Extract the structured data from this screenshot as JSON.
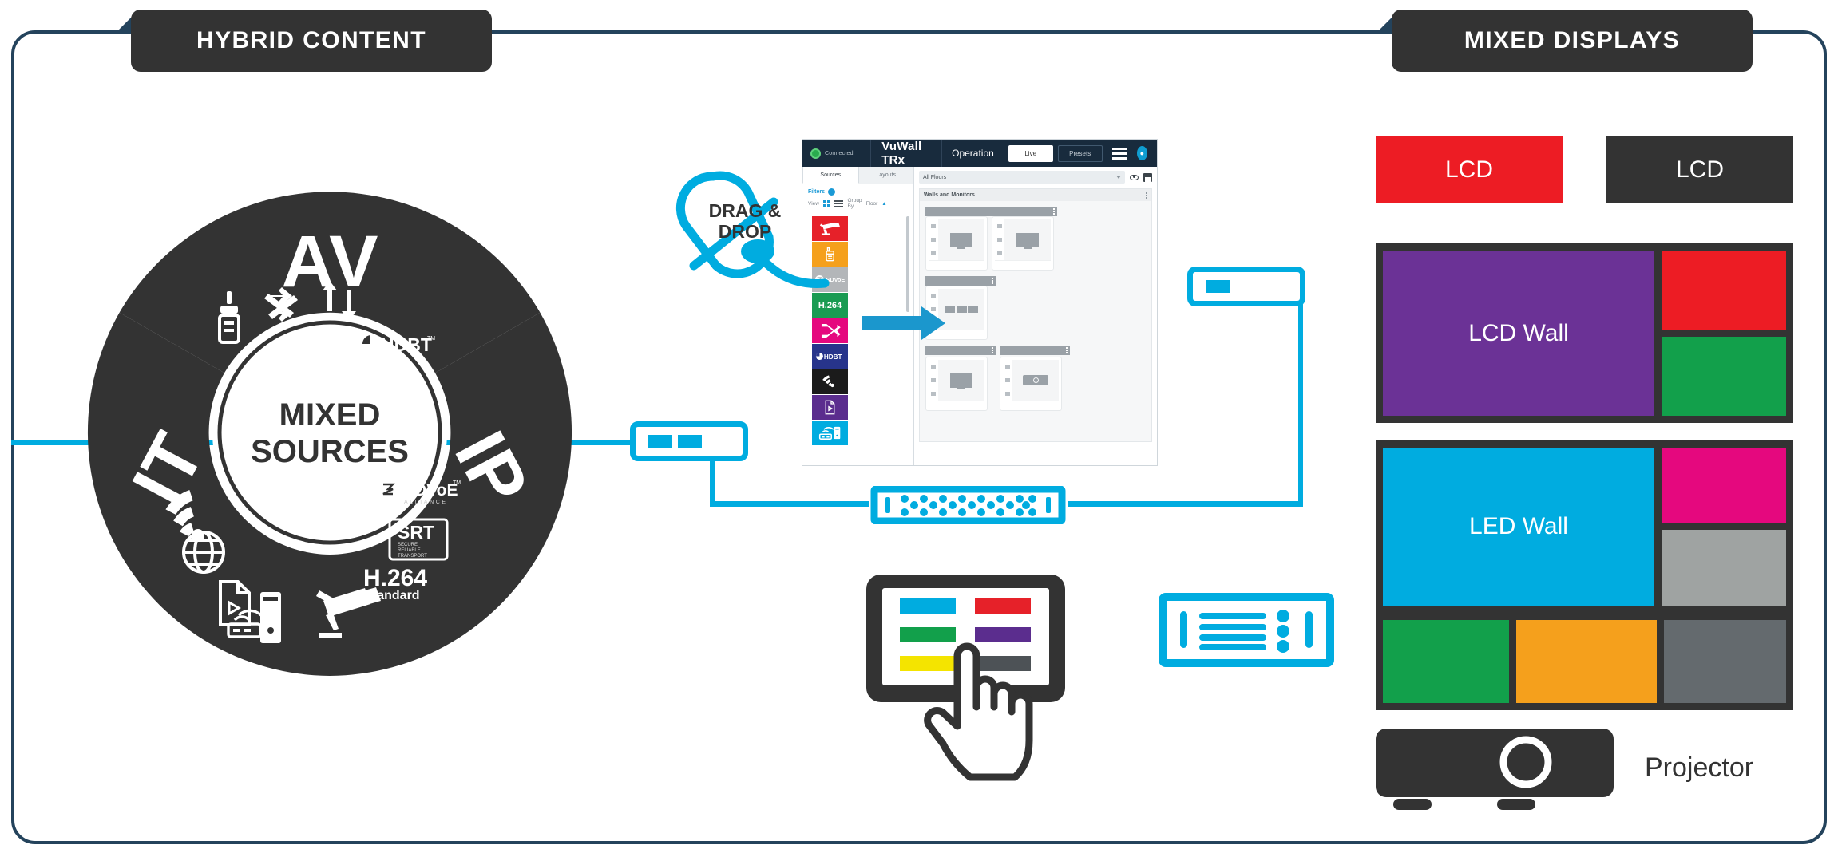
{
  "tabs": {
    "left": "HYBRID CONTENT",
    "right": "MIXED DISPLAYS"
  },
  "wheel": {
    "hub_line1": "MIXED",
    "hub_line2": "SOURCES",
    "segments": [
      {
        "label": "AV",
        "icons": [
          "hdmi-connector-icon",
          "shuffle-icon",
          "updown-arrows-icon",
          "hdbaset-logo"
        ]
      },
      {
        "label": "IP",
        "icons": [
          "sdvoe-logo",
          "srt-logo",
          "h264-label",
          "security-camera-icon"
        ]
      },
      {
        "label": "IT",
        "icons": [
          "wifi-icon",
          "globe-icon",
          "video-file-icon",
          "router-pc-icon"
        ]
      }
    ],
    "av_logo": "HDBT",
    "ip_logos": {
      "sdvoe": "SDVoE",
      "sdvoe_sub": "ALLIANCE",
      "srt": "SRT",
      "srt_sub": "SECURE RELIABLE TRANSPORT",
      "codec": "H.264",
      "codec_sub": "standard"
    },
    "colors": {
      "dark": "#333333",
      "hub_text": "#333333"
    }
  },
  "drag_drop": {
    "line1": "DRAG &",
    "line2": "DROP",
    "accent": "#00ace0"
  },
  "app": {
    "status": "Connected",
    "brand": "VuWall TRx",
    "mode": "Operation",
    "btn_live": "Live",
    "btn_presets": "Presets",
    "menu_icon": "hamburger-icon",
    "avatar_icon": "user-avatar-icon",
    "sidebar": {
      "tab_sources": "Sources",
      "tab_layouts": "Layouts",
      "filters_label": "Filters",
      "view_label": "View",
      "group_by_label": "Group By",
      "floor_label": "Floor",
      "sources": [
        {
          "name": "security-camera-source",
          "color": "#e62129",
          "glyph": "camera"
        },
        {
          "name": "hdmi-source",
          "color": "#f5a01c",
          "glyph": "hdmi"
        },
        {
          "name": "sdvoe-source",
          "color": "#b3b6b9",
          "glyph": "sdvoe",
          "text": "SDVoE"
        },
        {
          "name": "h264-source",
          "color": "#1a9b52",
          "glyph": "text",
          "text": "H.264"
        },
        {
          "name": "shuffle-source",
          "color": "#e5087e",
          "glyph": "shuffle"
        },
        {
          "name": "hdbaset-source",
          "color": "#27348b",
          "glyph": "text",
          "text": "HDBT"
        },
        {
          "name": "wifi-source",
          "color": "#1b1b1b",
          "glyph": "wifi"
        },
        {
          "name": "video-file-source",
          "color": "#5b2d8e",
          "glyph": "file"
        },
        {
          "name": "network-pc-source",
          "color": "#00ace0",
          "glyph": "router"
        }
      ]
    },
    "main": {
      "floors_filter": "All Floors",
      "panel_title": "Walls and Monitors",
      "eye_icon": "eye-icon",
      "save_icon": "save-icon",
      "groups": [
        {
          "cards": [
            "monitor",
            "monitor"
          ]
        },
        {
          "cards": [
            "triple-wall"
          ]
        },
        {
          "cards": [
            "monitor-multi",
            "projector"
          ]
        }
      ]
    }
  },
  "network": {
    "encoder_left": {
      "name": "encoder-node-left",
      "bars": 2
    },
    "encoder_right": {
      "name": "encoder-node-right",
      "bars": 1
    },
    "switch": {
      "name": "network-switch",
      "port_rows": 3
    },
    "decoder": {
      "name": "decoder-node",
      "bars": 4,
      "dots": 3
    },
    "accent": "#00ace0"
  },
  "tablet": {
    "name": "touch-tablet",
    "tiles": [
      "#00ace0",
      "#e62129",
      "#1a9b52",
      "#5b2d8e",
      "#f4e400",
      "#4d5256"
    ],
    "hand_icon": "pointing-hand-icon"
  },
  "displays": {
    "lcd_left": {
      "label": "LCD",
      "color": "#ed1c24"
    },
    "lcd_right": {
      "label": "LCD",
      "color": "#333333"
    },
    "lcd_wall": {
      "label": "LCD Wall",
      "main_color": "#6b3296",
      "tiles": [
        "#ed1c24",
        "#12a04b"
      ]
    },
    "led_wall": {
      "label": "LED Wall",
      "main_color": "#00ace0",
      "tiles": [
        "#e5087e",
        "#9fa3a2",
        "#12a04b",
        "#f5a01c",
        "#646a6e"
      ]
    },
    "projector": {
      "label": "Projector",
      "color": "#333333"
    }
  }
}
